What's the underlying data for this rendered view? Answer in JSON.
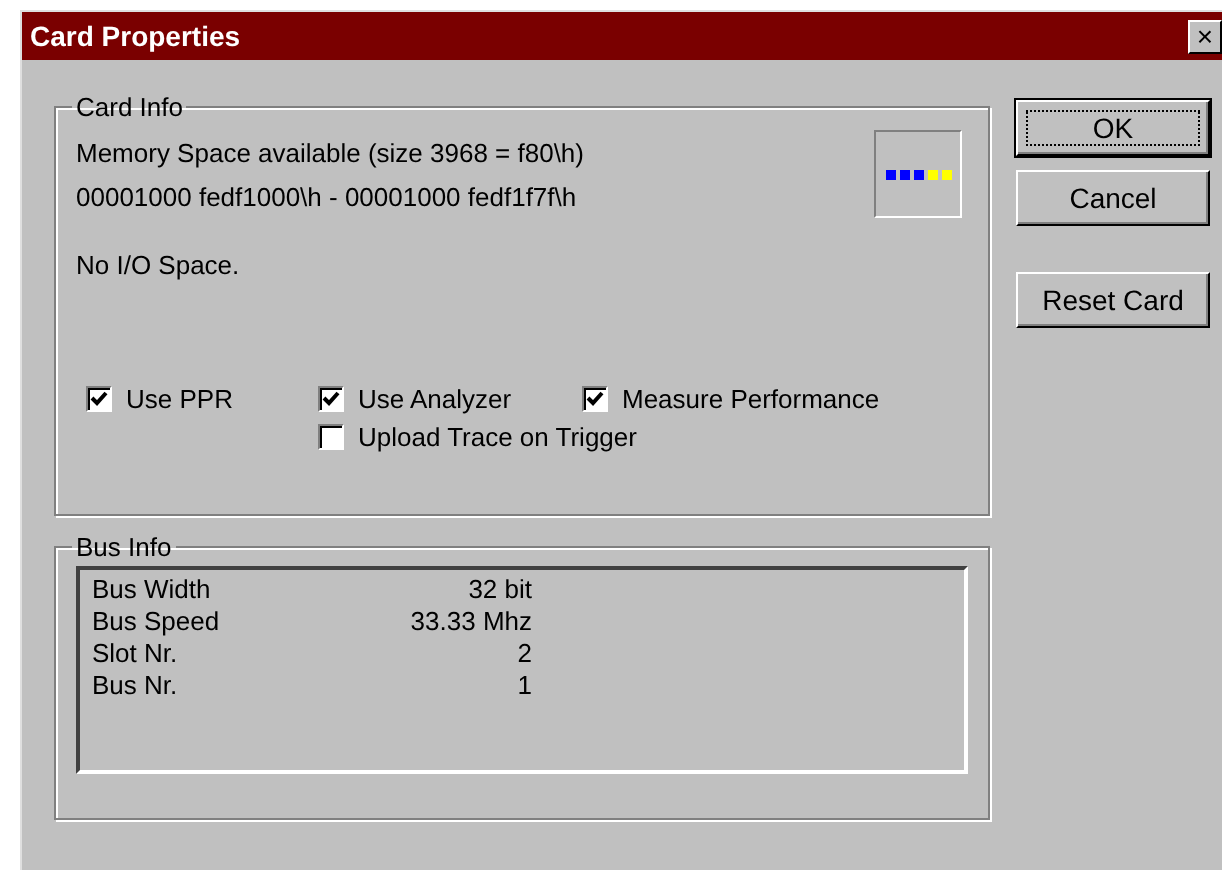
{
  "window": {
    "title": "Card Properties",
    "close": "×"
  },
  "card_info": {
    "title": "Card Info",
    "lines": [
      "Memory Space available (size 3968 = f80\\h)",
      "00001000 fedf1000\\h - 00001000 fedf1f7f\\h"
    ],
    "io": "No I/O Space.",
    "indicator": [
      {
        "color": "#0000ff"
      },
      {
        "color": "#0000ff"
      },
      {
        "color": "#0000ff"
      },
      {
        "color": "#ffff00"
      },
      {
        "color": "#ffff00"
      }
    ],
    "options": [
      {
        "label": "Use PPR",
        "checked": true
      },
      {
        "label": "Use Analyzer",
        "checked": true
      },
      {
        "label": "Measure Performance",
        "checked": true
      },
      {
        "label": "Upload Trace on Trigger",
        "checked": false
      }
    ]
  },
  "bus_info": {
    "title": "Bus Info",
    "rows": [
      {
        "name": "Bus Width",
        "value": "32 bit"
      },
      {
        "name": "Bus Speed",
        "value": "33.33 Mhz"
      },
      {
        "name": "Slot Nr.",
        "value": "2"
      },
      {
        "name": "Bus Nr.",
        "value": "1"
      }
    ]
  },
  "buttons": [
    {
      "label": "OK",
      "default": true
    },
    {
      "label": "Cancel",
      "default": false
    },
    {
      "label": "Reset Card",
      "default": false
    }
  ]
}
